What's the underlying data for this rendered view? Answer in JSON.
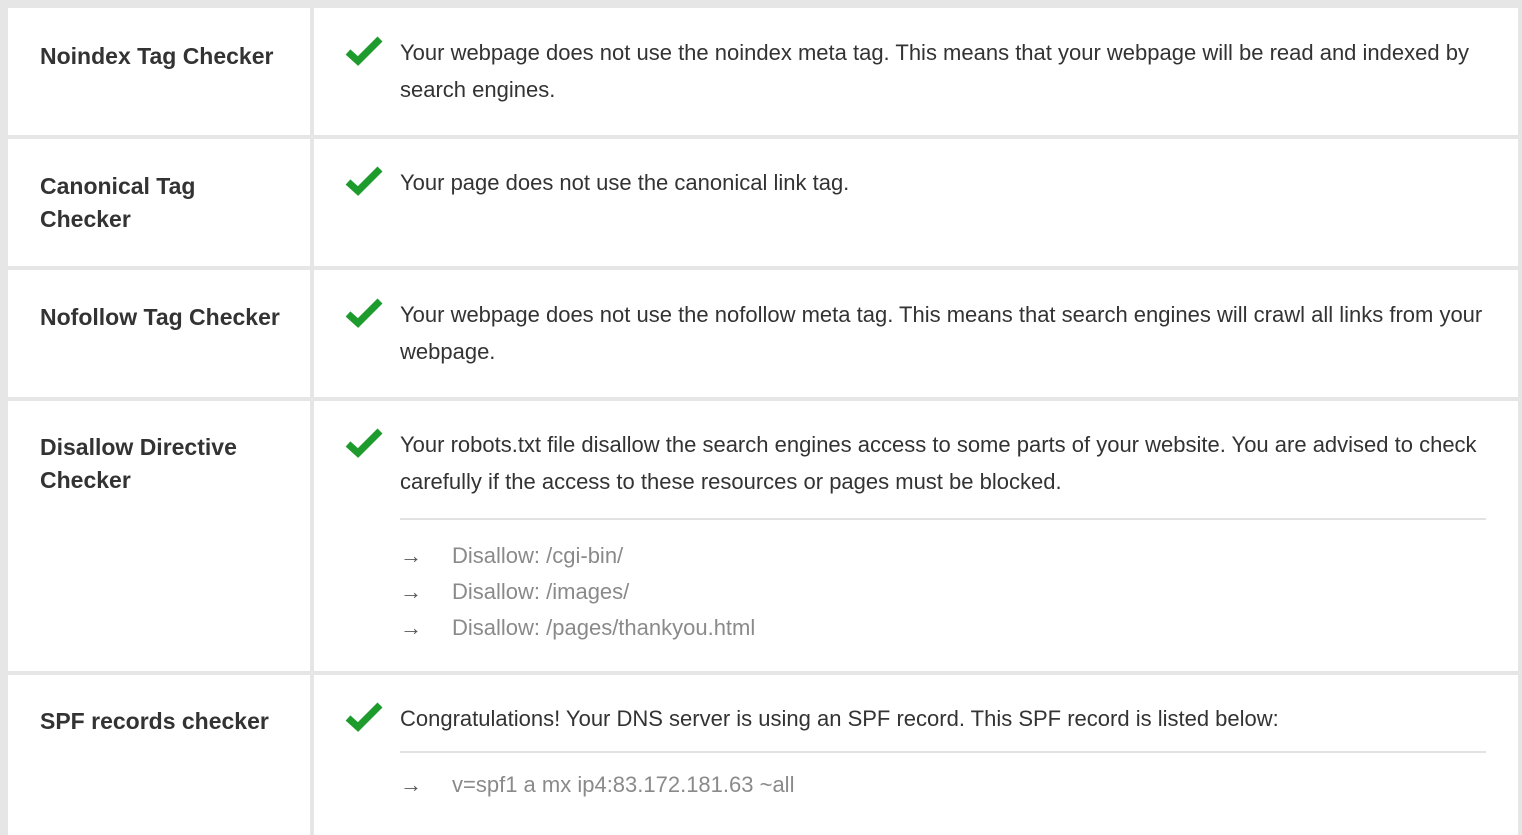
{
  "rows": [
    {
      "label": "Noindex Tag Checker",
      "status": "pass",
      "message": "Your webpage does not use the noindex meta tag. This means that your webpage will be read and indexed by search engines."
    },
    {
      "label": "Canonical Tag Checker",
      "status": "pass",
      "message": "Your page does not use the canonical link tag."
    },
    {
      "label": "Nofollow Tag Checker",
      "status": "pass",
      "message": "Your webpage does not use the nofollow meta tag. This means that search engines will crawl all links from your webpage."
    },
    {
      "label": "Disallow Directive Checker",
      "status": "pass",
      "message": "Your robots.txt file disallow the search engines access to some parts of your website. You are advised to check carefully if the access to these resources or pages must be blocked.",
      "items": [
        "Disallow: /cgi-bin/",
        "Disallow: /images/",
        "Disallow: /pages/thankyou.html"
      ]
    },
    {
      "label": "SPF records checker",
      "status": "pass",
      "message": "Congratulations! Your DNS server is using an SPF record. This SPF record is listed below:",
      "items": [
        "v=spf1 a mx ip4:83.172.181.63 ~all"
      ]
    }
  ],
  "icons": {
    "check": "check-icon",
    "arrow": "arrow-right-icon"
  },
  "colors": {
    "check": "#1e9b2d",
    "label": "#333333",
    "item_text": "#8a8a8a",
    "background": "#e6e6e6"
  }
}
